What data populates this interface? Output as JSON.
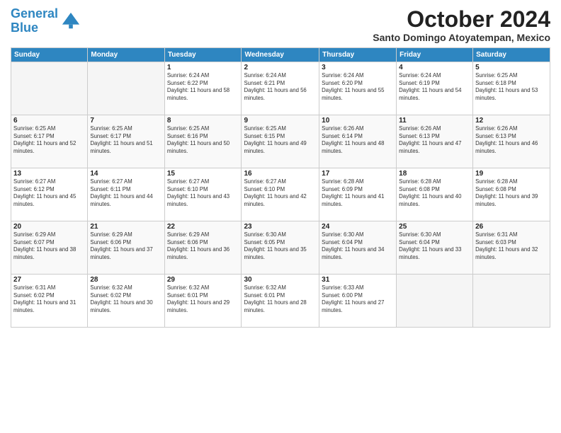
{
  "logo": {
    "line1": "General",
    "line2": "Blue"
  },
  "title": "October 2024",
  "location": "Santo Domingo Atoyatempan, Mexico",
  "days_of_week": [
    "Sunday",
    "Monday",
    "Tuesday",
    "Wednesday",
    "Thursday",
    "Friday",
    "Saturday"
  ],
  "weeks": [
    [
      {
        "day": "",
        "info": ""
      },
      {
        "day": "",
        "info": ""
      },
      {
        "day": "1",
        "info": "Sunrise: 6:24 AM\nSunset: 6:22 PM\nDaylight: 11 hours and 58 minutes."
      },
      {
        "day": "2",
        "info": "Sunrise: 6:24 AM\nSunset: 6:21 PM\nDaylight: 11 hours and 56 minutes."
      },
      {
        "day": "3",
        "info": "Sunrise: 6:24 AM\nSunset: 6:20 PM\nDaylight: 11 hours and 55 minutes."
      },
      {
        "day": "4",
        "info": "Sunrise: 6:24 AM\nSunset: 6:19 PM\nDaylight: 11 hours and 54 minutes."
      },
      {
        "day": "5",
        "info": "Sunrise: 6:25 AM\nSunset: 6:18 PM\nDaylight: 11 hours and 53 minutes."
      }
    ],
    [
      {
        "day": "6",
        "info": "Sunrise: 6:25 AM\nSunset: 6:17 PM\nDaylight: 11 hours and 52 minutes."
      },
      {
        "day": "7",
        "info": "Sunrise: 6:25 AM\nSunset: 6:17 PM\nDaylight: 11 hours and 51 minutes."
      },
      {
        "day": "8",
        "info": "Sunrise: 6:25 AM\nSunset: 6:16 PM\nDaylight: 11 hours and 50 minutes."
      },
      {
        "day": "9",
        "info": "Sunrise: 6:25 AM\nSunset: 6:15 PM\nDaylight: 11 hours and 49 minutes."
      },
      {
        "day": "10",
        "info": "Sunrise: 6:26 AM\nSunset: 6:14 PM\nDaylight: 11 hours and 48 minutes."
      },
      {
        "day": "11",
        "info": "Sunrise: 6:26 AM\nSunset: 6:13 PM\nDaylight: 11 hours and 47 minutes."
      },
      {
        "day": "12",
        "info": "Sunrise: 6:26 AM\nSunset: 6:13 PM\nDaylight: 11 hours and 46 minutes."
      }
    ],
    [
      {
        "day": "13",
        "info": "Sunrise: 6:27 AM\nSunset: 6:12 PM\nDaylight: 11 hours and 45 minutes."
      },
      {
        "day": "14",
        "info": "Sunrise: 6:27 AM\nSunset: 6:11 PM\nDaylight: 11 hours and 44 minutes."
      },
      {
        "day": "15",
        "info": "Sunrise: 6:27 AM\nSunset: 6:10 PM\nDaylight: 11 hours and 43 minutes."
      },
      {
        "day": "16",
        "info": "Sunrise: 6:27 AM\nSunset: 6:10 PM\nDaylight: 11 hours and 42 minutes."
      },
      {
        "day": "17",
        "info": "Sunrise: 6:28 AM\nSunset: 6:09 PM\nDaylight: 11 hours and 41 minutes."
      },
      {
        "day": "18",
        "info": "Sunrise: 6:28 AM\nSunset: 6:08 PM\nDaylight: 11 hours and 40 minutes."
      },
      {
        "day": "19",
        "info": "Sunrise: 6:28 AM\nSunset: 6:08 PM\nDaylight: 11 hours and 39 minutes."
      }
    ],
    [
      {
        "day": "20",
        "info": "Sunrise: 6:29 AM\nSunset: 6:07 PM\nDaylight: 11 hours and 38 minutes."
      },
      {
        "day": "21",
        "info": "Sunrise: 6:29 AM\nSunset: 6:06 PM\nDaylight: 11 hours and 37 minutes."
      },
      {
        "day": "22",
        "info": "Sunrise: 6:29 AM\nSunset: 6:06 PM\nDaylight: 11 hours and 36 minutes."
      },
      {
        "day": "23",
        "info": "Sunrise: 6:30 AM\nSunset: 6:05 PM\nDaylight: 11 hours and 35 minutes."
      },
      {
        "day": "24",
        "info": "Sunrise: 6:30 AM\nSunset: 6:04 PM\nDaylight: 11 hours and 34 minutes."
      },
      {
        "day": "25",
        "info": "Sunrise: 6:30 AM\nSunset: 6:04 PM\nDaylight: 11 hours and 33 minutes."
      },
      {
        "day": "26",
        "info": "Sunrise: 6:31 AM\nSunset: 6:03 PM\nDaylight: 11 hours and 32 minutes."
      }
    ],
    [
      {
        "day": "27",
        "info": "Sunrise: 6:31 AM\nSunset: 6:02 PM\nDaylight: 11 hours and 31 minutes."
      },
      {
        "day": "28",
        "info": "Sunrise: 6:32 AM\nSunset: 6:02 PM\nDaylight: 11 hours and 30 minutes."
      },
      {
        "day": "29",
        "info": "Sunrise: 6:32 AM\nSunset: 6:01 PM\nDaylight: 11 hours and 29 minutes."
      },
      {
        "day": "30",
        "info": "Sunrise: 6:32 AM\nSunset: 6:01 PM\nDaylight: 11 hours and 28 minutes."
      },
      {
        "day": "31",
        "info": "Sunrise: 6:33 AM\nSunset: 6:00 PM\nDaylight: 11 hours and 27 minutes."
      },
      {
        "day": "",
        "info": ""
      },
      {
        "day": "",
        "info": ""
      }
    ]
  ]
}
